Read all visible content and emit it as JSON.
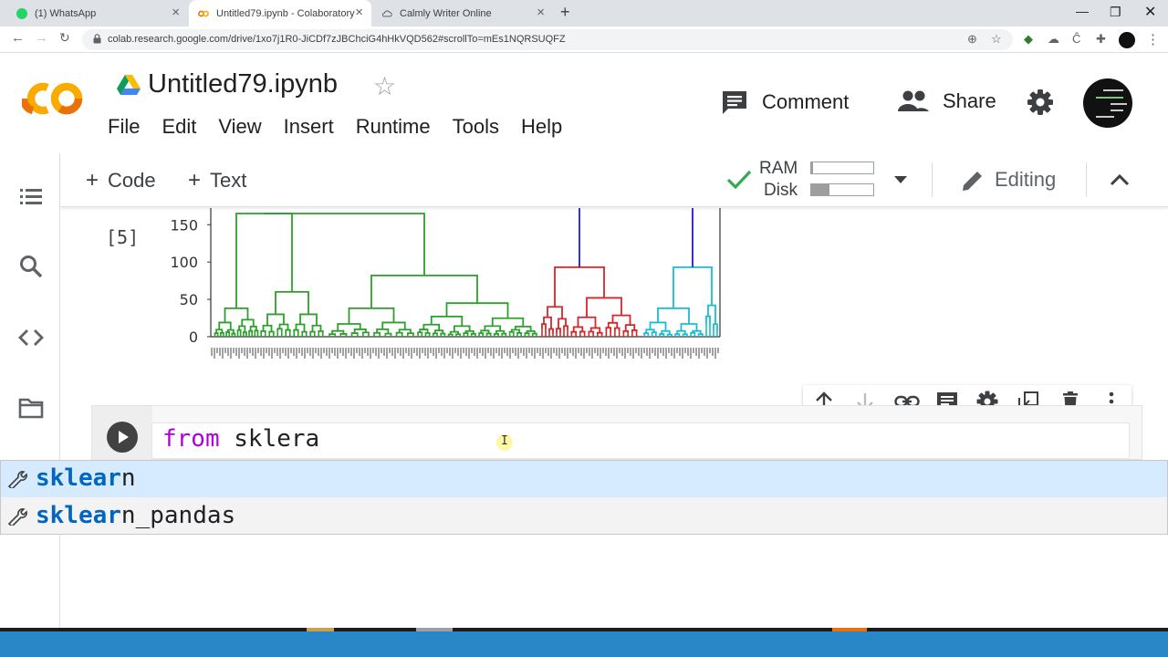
{
  "browser": {
    "tabs": [
      {
        "title": "(1) WhatsApp",
        "active": false
      },
      {
        "title": "Untitled79.ipynb - Colaboratory",
        "active": true
      },
      {
        "title": "Calmly Writer Online",
        "active": false
      }
    ],
    "new_tab_icon": "plus-icon",
    "window_controls": [
      "minimize-icon",
      "maximize-icon",
      "close-icon"
    ],
    "url": "colab.research.google.com/drive/1xo7j1R0-JiCDf7zJBChciG4hHkVQD562#scrollTo=mEs1NQRSUQFZ"
  },
  "header": {
    "logo_text": "CO",
    "notebook_title": "Untitled79.ipynb",
    "menu": [
      "File",
      "Edit",
      "View",
      "Insert",
      "Runtime",
      "Tools",
      "Help"
    ],
    "comment_label": "Comment",
    "share_label": "Share"
  },
  "toolbar": {
    "add_code_label": "Code",
    "add_text_label": "Text",
    "ram_label": "RAM",
    "disk_label": "Disk",
    "ram_usage": 0.03,
    "disk_usage": 0.3,
    "editing_label": "Editing"
  },
  "output": {
    "execution_count": "[5]"
  },
  "chart_data": {
    "type": "dendrogram",
    "yticks": [
      "150",
      "100",
      "50",
      "0"
    ],
    "ylim": [
      0,
      165
    ],
    "cluster_colors": [
      "#2ca02c",
      "#d62728",
      "#17becf"
    ],
    "link_color": "#1f1fbf"
  },
  "cell": {
    "code_keyword": "from",
    "code_rest": " sklera"
  },
  "autocomplete": [
    {
      "match": "sklear",
      "rest": "n",
      "selected": true
    },
    {
      "match": "sklear",
      "rest": "n_pandas",
      "selected": false
    }
  ],
  "colors": {
    "colab_orange": "#f9ab00",
    "colab_dark_orange": "#e8710a",
    "keyword_purple": "#af00db",
    "taskbar_blue": "#2a87c7",
    "selection_blue": "#d6ebff"
  }
}
